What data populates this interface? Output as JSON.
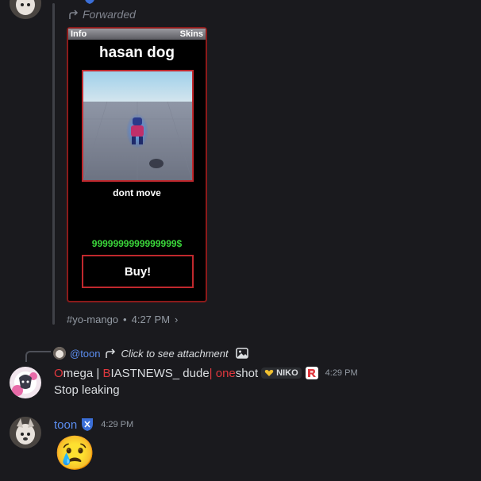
{
  "forward": {
    "label": "Forwarded",
    "card": {
      "tab_left": "Info",
      "tab_right": "Skins",
      "title": "hasan dog",
      "description": "dont move",
      "price": "9999999999999999$",
      "buy_label": "Buy!"
    },
    "channel": "#yo-mango",
    "time": "4:27 PM"
  },
  "reply": {
    "mention": "@toon",
    "attachment_text": "Click to see attachment"
  },
  "message1": {
    "name_parts": [
      "O",
      "mega | ",
      "B",
      "IASTNEWS_ dude",
      "|",
      " one",
      "shot"
    ],
    "tag_label": "NIKO",
    "time": "4:29 PM",
    "text": "Stop leaking"
  },
  "message2": {
    "name": "toon",
    "time": "4:29 PM",
    "emoji": "😢"
  },
  "colors": {
    "background": "#1a1a1e",
    "link_blue": "#5b8def",
    "red": "#e0383e",
    "green": "#3ad63a"
  }
}
